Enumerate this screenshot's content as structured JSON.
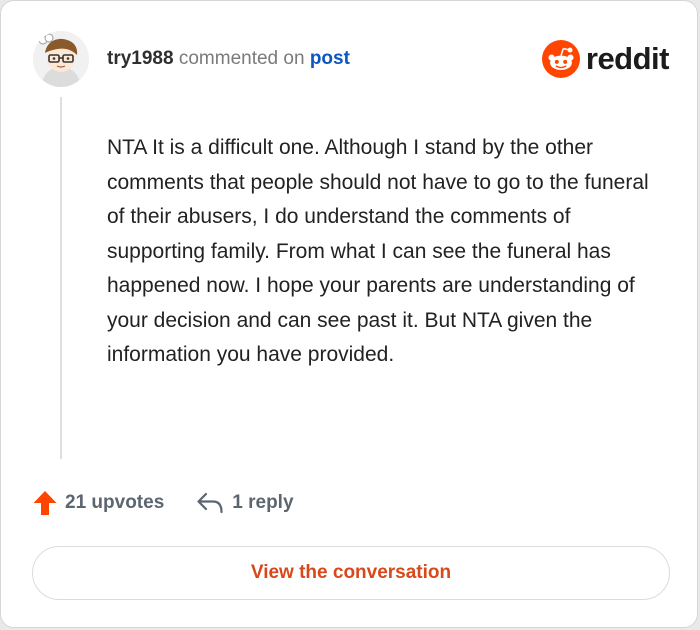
{
  "comment": {
    "author": "try1988",
    "action_text": "commented on",
    "target_text": "post",
    "body": "NTA It is a difficult one. Although I stand by the other comments that people should not have to go to the funeral of their abusers, I do understand the comments of supporting family. From what I can see the funeral has happened now. I hope your parents are understanding of your decision and can see past it. But NTA given the information you have provided."
  },
  "brand": {
    "name": "reddit",
    "accent": "#ff4500"
  },
  "actions": {
    "upvotes": "21 upvotes",
    "replies": "1 reply"
  },
  "cta": {
    "label": "View the conversation"
  },
  "colors": {
    "link": "#0b56c0",
    "upvote": "#ff4500",
    "cta_text": "#d9481a"
  },
  "icons": {
    "avatar": "user-avatar",
    "brand": "reddit-logo-icon",
    "upvote": "upvote-arrow-icon",
    "reply": "reply-arrow-icon"
  }
}
